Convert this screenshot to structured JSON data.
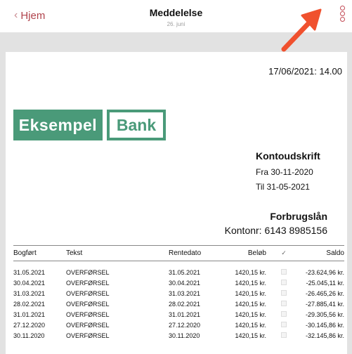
{
  "nav": {
    "back_label": "Hjem",
    "title": "Meddelelse",
    "subtitle": "26. juni"
  },
  "document": {
    "datetime": "17/06/2021: 14.00",
    "logo": {
      "part1": "Eksempel",
      "part2": "Bank"
    },
    "heading": "Kontoudskrift",
    "period_from": "Fra 30-11-2020",
    "period_to": "Til 31-05-2021",
    "account_type": "Forbrugslån",
    "account_no": "Kontonr: 6143 8985156"
  },
  "table": {
    "headers": {
      "booked": "Bogført",
      "text": "Tekst",
      "value_date": "Rentedato",
      "amount": "Beløb",
      "check": "✓",
      "balance": "Saldo"
    },
    "rows": [
      {
        "booked": "31.05.2021",
        "text": "OVERFØRSEL",
        "value_date": "31.05.2021",
        "amount": "1420,15 kr.",
        "balance": "-23.624,96 kr."
      },
      {
        "booked": "30.04.2021",
        "text": "OVERFØRSEL",
        "value_date": "30.04.2021",
        "amount": "1420,15 kr.",
        "balance": "-25.045,11 kr."
      },
      {
        "booked": "31.03.2021",
        "text": "OVERFØRSEL",
        "value_date": "31.03.2021",
        "amount": "1420,15 kr.",
        "balance": "-26.465,26 kr."
      },
      {
        "booked": "28.02.2021",
        "text": "OVERFØRSEL",
        "value_date": "28.02.2021",
        "amount": "1420,15 kr.",
        "balance": "-27.885,41 kr."
      },
      {
        "booked": "31.01.2021",
        "text": "OVERFØRSEL",
        "value_date": "31.01.2021",
        "amount": "1420,15 kr.",
        "balance": "-29.305,56 kr."
      },
      {
        "booked": "27.12.2020",
        "text": "OVERFØRSEL",
        "value_date": "27.12.2020",
        "amount": "1420,15 kr.",
        "balance": "-30.145,86 kr."
      },
      {
        "booked": "30.11.2020",
        "text": "OVERFØRSEL",
        "value_date": "30.11.2020",
        "amount": "1420,15 kr.",
        "balance": "-32.145,86 kr."
      }
    ]
  },
  "icons": {
    "more": "more-vertical-icon",
    "annotation": "red-arrow-icon",
    "back": "chevron-left-icon"
  },
  "colors": {
    "brand_green": "#4a9a79",
    "accent_red": "#b0434c",
    "annotation_arrow": "#f0512e"
  }
}
